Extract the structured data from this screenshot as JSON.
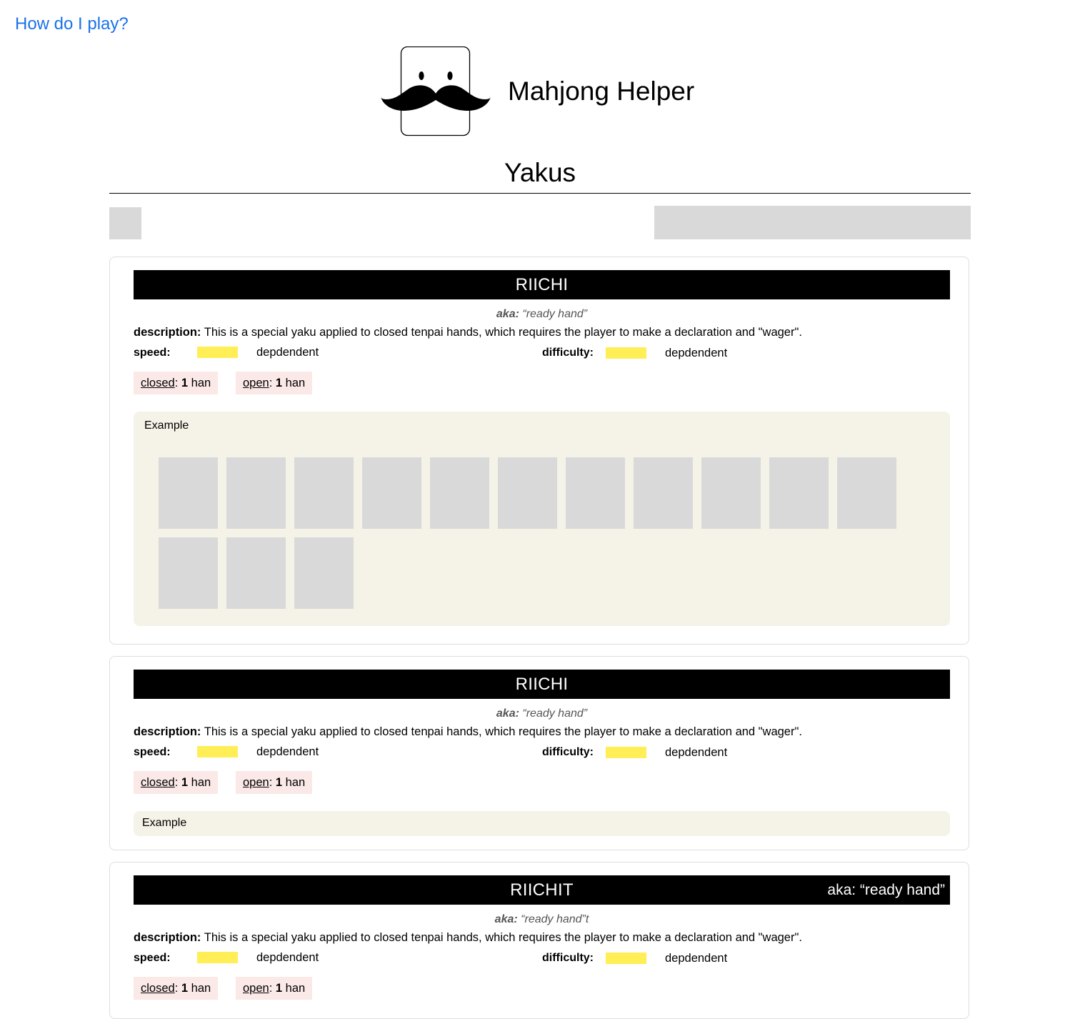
{
  "nav": {
    "help_link": "How do I play?"
  },
  "brand": {
    "app_title": "Mahjong Helper",
    "logo_icon": "mustache-tile-icon"
  },
  "page": {
    "title": "Yakus"
  },
  "colors": {
    "accent_link": "#1a73e8",
    "header_bg": "#000000",
    "swatch": "#ffee55",
    "badge_bg": "#fbe9e8",
    "example_bg": "#f5f3e7"
  },
  "cards": [
    {
      "title": "RIICHI",
      "header_aka": "",
      "aka_label": "aka:",
      "aka_value": "“ready hand”",
      "description_label": "description:",
      "description": "This is a special yaku applied to closed tenpai hands, which requires the player to make a declaration and \"wager\".",
      "speed_label": "speed:",
      "speed_value": "depdendent",
      "difficulty_label": "difficulty:",
      "difficulty_value": "depdendent",
      "closed_label": "closed",
      "closed_han": "1",
      "open_label": "open",
      "open_han": "1",
      "han_unit": "han",
      "example_label": "Example",
      "example_tiles": 14
    },
    {
      "title": "RIICHI",
      "header_aka": "",
      "aka_label": "aka:",
      "aka_value": "“ready hand”",
      "description_label": "description:",
      "description": "This is a special yaku applied to closed tenpai hands, which requires the player to make a declaration and \"wager\".",
      "speed_label": "speed:",
      "speed_value": "depdendent",
      "difficulty_label": "difficulty:",
      "difficulty_value": "depdendent",
      "closed_label": "closed",
      "closed_han": "1",
      "open_label": "open",
      "open_han": "1",
      "han_unit": "han",
      "example_label": "Example",
      "example_tiles": 0
    },
    {
      "title": "RIICHIT",
      "header_aka": "aka: “ready hand”",
      "aka_label": "aka:",
      "aka_value": "“ready hand”t",
      "description_label": "description:",
      "description": "This is a special yaku applied to closed tenpai hands, which requires the player to make a declaration and \"wager\".",
      "speed_label": "speed:",
      "speed_value": "depdendent",
      "difficulty_label": "difficulty:",
      "difficulty_value": "depdendent",
      "closed_label": "closed",
      "closed_han": "1",
      "open_label": "open",
      "open_han": "1",
      "han_unit": "han",
      "example_label": "",
      "example_tiles": 0
    }
  ]
}
